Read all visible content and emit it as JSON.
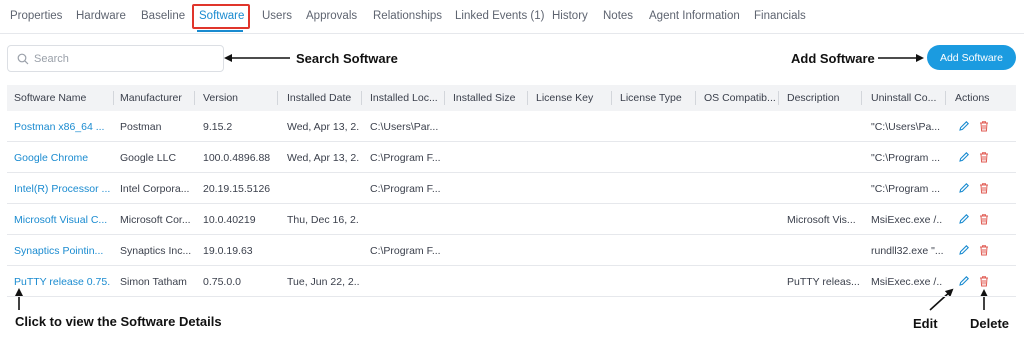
{
  "tabs": [
    {
      "label": "Properties"
    },
    {
      "label": "Hardware"
    },
    {
      "label": "Baseline"
    },
    {
      "label": "Software"
    },
    {
      "label": "Users"
    },
    {
      "label": "Approvals"
    },
    {
      "label": "Relationships"
    },
    {
      "label": "Linked Events (1)"
    },
    {
      "label": "History"
    },
    {
      "label": "Notes"
    },
    {
      "label": "Agent Information"
    },
    {
      "label": "Financials"
    }
  ],
  "active_tab": "Software",
  "search": {
    "placeholder": "Search",
    "value": ""
  },
  "add_button": {
    "label": "Add Software"
  },
  "annotations": {
    "search": "Search Software",
    "add": "Add Software",
    "details": "Click to view the Software Details",
    "edit": "Edit",
    "delete": "Delete"
  },
  "table": {
    "columns": [
      "Software Name",
      "Manufacturer",
      "Version",
      "Installed Date",
      "Installed Loc...",
      "Installed Size",
      "License Key",
      "License Type",
      "OS Compatib...",
      "Description",
      "Uninstall Co...",
      "Actions"
    ],
    "rows": [
      {
        "name": "Postman x86_64 ...",
        "manufacturer": "Postman",
        "version": "9.15.2",
        "installed_date": "Wed, Apr 13, 2...",
        "installed_loc": "C:\\Users\\Par...",
        "installed_size": "",
        "license_key": "",
        "license_type": "",
        "os": "",
        "description": "",
        "uninstall": "\"C:\\Users\\Pa..."
      },
      {
        "name": "Google Chrome",
        "manufacturer": "Google LLC",
        "version": "100.0.4896.88",
        "installed_date": "Wed, Apr 13, 2...",
        "installed_loc": "C:\\Program F...",
        "installed_size": "",
        "license_key": "",
        "license_type": "",
        "os": "",
        "description": "",
        "uninstall": "\"C:\\Program ..."
      },
      {
        "name": "Intel(R) Processor ...",
        "manufacturer": "Intel Corpora...",
        "version": "20.19.15.5126",
        "installed_date": "",
        "installed_loc": "C:\\Program F...",
        "installed_size": "",
        "license_key": "",
        "license_type": "",
        "os": "",
        "description": "",
        "uninstall": "\"C:\\Program ..."
      },
      {
        "name": "Microsoft Visual C...",
        "manufacturer": "Microsoft Cor...",
        "version": "10.0.40219",
        "installed_date": "Thu, Dec 16, 2...",
        "installed_loc": "",
        "installed_size": "",
        "license_key": "",
        "license_type": "",
        "os": "",
        "description": "Microsoft Vis...",
        "uninstall": "MsiExec.exe /..."
      },
      {
        "name": "Synaptics Pointin...",
        "manufacturer": "Synaptics Inc...",
        "version": "19.0.19.63",
        "installed_date": "",
        "installed_loc": "C:\\Program F...",
        "installed_size": "",
        "license_key": "",
        "license_type": "",
        "os": "",
        "description": "",
        "uninstall": "rundll32.exe \"..."
      },
      {
        "name": "PuTTY release 0.75...",
        "manufacturer": "Simon Tatham",
        "version": "0.75.0.0",
        "installed_date": "Tue, Jun 22, 2...",
        "installed_loc": "",
        "installed_size": "",
        "license_key": "",
        "license_type": "",
        "os": "",
        "description": "PuTTY releas...",
        "uninstall": "MsiExec.exe /..."
      }
    ]
  },
  "icons": {
    "search": "search-icon",
    "edit": "pencil-icon",
    "delete": "trash-icon"
  },
  "colors": {
    "accent": "#1a8bd0",
    "button": "#1b9be0",
    "highlight": "#e0352b",
    "delete": "#e05a52"
  }
}
